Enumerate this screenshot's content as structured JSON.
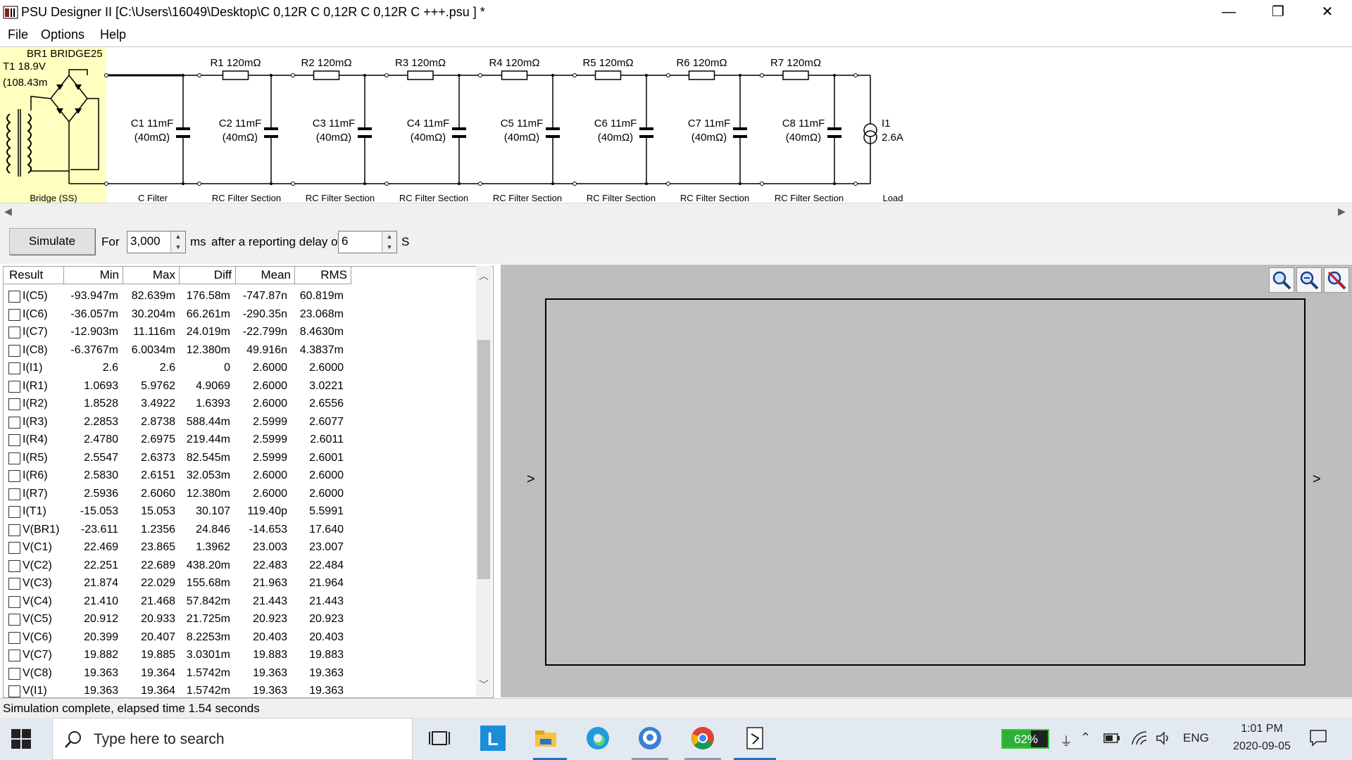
{
  "window": {
    "title": "PSU Designer II  [C:\\Users\\16049\\Desktop\\C 0,12R C 0,12R C 0,12R C +++.psu ] *",
    "min_glyph": "—",
    "restore_glyph": "❐",
    "close_glyph": "✕"
  },
  "menu": [
    "File",
    "Options",
    "Help"
  ],
  "schematic": {
    "bridge_label": "BR1 BRIDGE25",
    "transformer_label": "T1 18.9V",
    "transformer_res": "(108.43m",
    "resistors": [
      "R1 120mΩ",
      "R2 120mΩ",
      "R3 120mΩ",
      "R4 120mΩ",
      "R5 120mΩ",
      "R6 120mΩ",
      "R7 120mΩ"
    ],
    "caps": [
      {
        "name": "C1 11mF",
        "esr": "(40mΩ)"
      },
      {
        "name": "C2 11mF",
        "esr": "(40mΩ)"
      },
      {
        "name": "C3 11mF",
        "esr": "(40mΩ)"
      },
      {
        "name": "C4 11mF",
        "esr": "(40mΩ)"
      },
      {
        "name": "C5 11mF",
        "esr": "(40mΩ)"
      },
      {
        "name": "C6 11mF",
        "esr": "(40mΩ)"
      },
      {
        "name": "C7 11mF",
        "esr": "(40mΩ)"
      },
      {
        "name": "C8 11mF",
        "esr": "(40mΩ)"
      }
    ],
    "load_name": "I1",
    "load_value": "2.6A",
    "sections": [
      "Bridge (SS)",
      "C Filter",
      "RC Filter Section",
      "RC Filter Section",
      "RC Filter Section",
      "RC Filter Section",
      "RC Filter Section",
      "RC Filter Section",
      "RC Filter Section",
      "Load"
    ]
  },
  "sim": {
    "button": "Simulate",
    "for_label": "For",
    "duration": "3,000",
    "ms_label": "ms",
    "delay_label": "after a reporting delay of",
    "delay": "6",
    "s_label": "S"
  },
  "table": {
    "headers": [
      "Result",
      "Min",
      "Max",
      "Diff",
      "Mean",
      "RMS"
    ],
    "rows": [
      [
        "I(C5)",
        "-93.947m",
        "82.639m",
        "176.58m",
        "-747.87n",
        "60.819m"
      ],
      [
        "I(C6)",
        "-36.057m",
        "30.204m",
        "66.261m",
        "-290.35n",
        "23.068m"
      ],
      [
        "I(C7)",
        "-12.903m",
        "11.116m",
        "24.019m",
        "-22.799n",
        "8.4630m"
      ],
      [
        "I(C8)",
        "-6.3767m",
        "6.0034m",
        "12.380m",
        "49.916n",
        "4.3837m"
      ],
      [
        "I(I1)",
        "2.6",
        "2.6",
        "0",
        "2.6000",
        "2.6000"
      ],
      [
        "I(R1)",
        "1.0693",
        "5.9762",
        "4.9069",
        "2.6000",
        "3.0221"
      ],
      [
        "I(R2)",
        "1.8528",
        "3.4922",
        "1.6393",
        "2.6000",
        "2.6556"
      ],
      [
        "I(R3)",
        "2.2853",
        "2.8738",
        "588.44m",
        "2.5999",
        "2.6077"
      ],
      [
        "I(R4)",
        "2.4780",
        "2.6975",
        "219.44m",
        "2.5999",
        "2.6011"
      ],
      [
        "I(R5)",
        "2.5547",
        "2.6373",
        "82.545m",
        "2.5999",
        "2.6001"
      ],
      [
        "I(R6)",
        "2.5830",
        "2.6151",
        "32.053m",
        "2.6000",
        "2.6000"
      ],
      [
        "I(R7)",
        "2.5936",
        "2.6060",
        "12.380m",
        "2.6000",
        "2.6000"
      ],
      [
        "I(T1)",
        "-15.053",
        "15.053",
        "30.107",
        "119.40p",
        "5.5991"
      ],
      [
        "V(BR1)",
        "-23.611",
        "1.2356",
        "24.846",
        "-14.653",
        "17.640"
      ],
      [
        "V(C1)",
        "22.469",
        "23.865",
        "1.3962",
        "23.003",
        "23.007"
      ],
      [
        "V(C2)",
        "22.251",
        "22.689",
        "438.20m",
        "22.483",
        "22.484"
      ],
      [
        "V(C3)",
        "21.874",
        "22.029",
        "155.68m",
        "21.963",
        "21.964"
      ],
      [
        "V(C4)",
        "21.410",
        "21.468",
        "57.842m",
        "21.443",
        "21.443"
      ],
      [
        "V(C5)",
        "20.912",
        "20.933",
        "21.725m",
        "20.923",
        "20.923"
      ],
      [
        "V(C6)",
        "20.399",
        "20.407",
        "8.2253m",
        "20.403",
        "20.403"
      ],
      [
        "V(C7)",
        "19.882",
        "19.885",
        "3.0301m",
        "19.883",
        "19.883"
      ],
      [
        "V(C8)",
        "19.363",
        "19.364",
        "1.5742m",
        "19.363",
        "19.363"
      ],
      [
        "V(I1)",
        "19.363",
        "19.364",
        "1.5742m",
        "19.363",
        "19.363"
      ]
    ]
  },
  "graph": {
    "left_marker": ">",
    "right_marker": ">"
  },
  "status": "Simulation complete, elapsed time 1.54 seconds",
  "taskbar": {
    "search_placeholder": "Type here to search",
    "battery": "62%",
    "lang": "ENG",
    "time": "1:01 PM",
    "date": "2020-09-05"
  }
}
